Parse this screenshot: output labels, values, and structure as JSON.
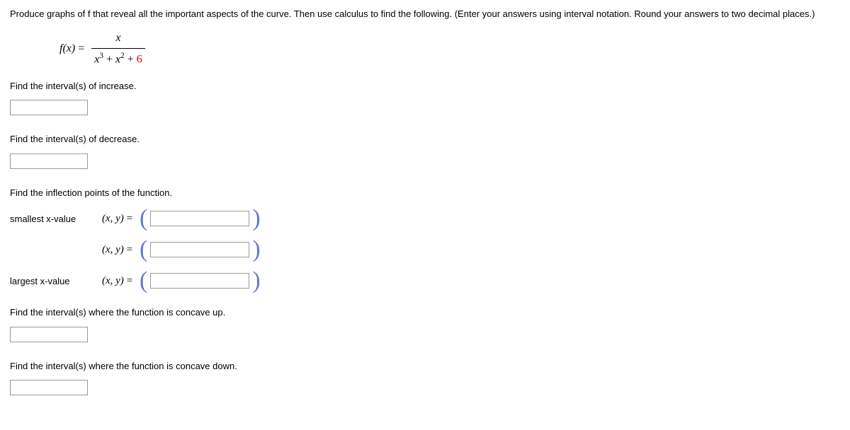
{
  "instruction": "Produce graphs of f that reveal all the important aspects of the curve. Then use calculus to find the following. (Enter your answers using interval notation. Round your answers to two decimal places.)",
  "equation": {
    "lhs": "f(x)",
    "eq": "=",
    "numerator": "x",
    "denominator_term1_base": "x",
    "denominator_term1_exp": "3",
    "denominator_plus1": " + ",
    "denominator_term2_base": "x",
    "denominator_term2_exp": "2",
    "denominator_plus2": " + ",
    "denominator_constant": "6"
  },
  "prompts": {
    "increase": "Find the interval(s) of increase.",
    "decrease": "Find the interval(s) of decrease.",
    "inflection_title": "Find the inflection points of the function.",
    "smallest_label": "smallest x-value",
    "largest_label": "largest x-value",
    "xy_label": "(x, y)",
    "xy_eq": " = ",
    "concave_up": "Find the interval(s) where the function is concave up.",
    "concave_down": "Find the interval(s) where the function is concave down."
  },
  "values": {
    "increase": "",
    "decrease": "",
    "inflection1": "",
    "inflection2": "",
    "inflection3": "",
    "concave_up": "",
    "concave_down": ""
  }
}
